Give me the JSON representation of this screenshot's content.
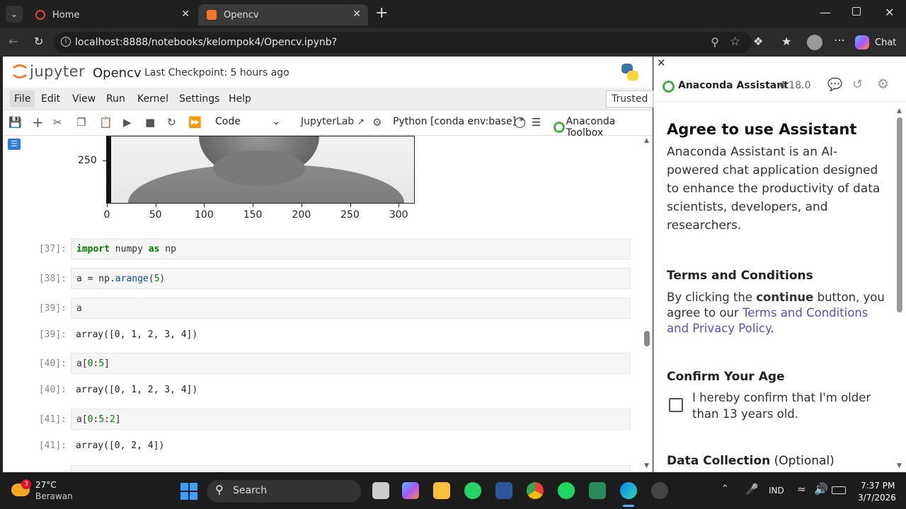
{
  "browser": {
    "tabs": [
      {
        "title": "Home"
      },
      {
        "title": "Opencv"
      }
    ],
    "url": "localhost:8888/notebooks/kelompok4/Opencv.ipynb?",
    "chat_label": "Chat"
  },
  "jupyter": {
    "logo_text": "jupyter",
    "notebook_name": "Opencv",
    "checkpoint": "Last Checkpoint: 5 hours ago",
    "menus": [
      "File",
      "Edit",
      "View",
      "Run",
      "Kernel",
      "Settings",
      "Help"
    ],
    "trusted": "Trusted",
    "cell_type": "Code",
    "jupyterlab_label": "JupyterLab",
    "kernel": "Python [conda env:base] *",
    "toolbox": "Anaconda Toolbox"
  },
  "plot": {
    "ytick": "250",
    "xticks": [
      "0",
      "50",
      "100",
      "150",
      "200",
      "250",
      "300"
    ]
  },
  "cells": [
    {
      "prompt": "[37]:",
      "code_parts": [
        {
          "t": "import",
          "c": "kw"
        },
        {
          "t": " numpy ",
          "c": ""
        },
        {
          "t": "as",
          "c": "kw"
        },
        {
          "t": " np",
          "c": ""
        }
      ]
    },
    {
      "prompt": "[38]:",
      "code_parts": [
        {
          "t": "a = np.",
          "c": ""
        },
        {
          "t": "arange",
          "c": "fn"
        },
        {
          "t": "(",
          "c": ""
        },
        {
          "t": "5",
          "c": "num"
        },
        {
          "t": ")",
          "c": ""
        }
      ]
    },
    {
      "prompt": "[39]:",
      "code_parts": [
        {
          "t": "a",
          "c": ""
        }
      ],
      "out_prompt": "[39]:",
      "output": "array([0, 1, 2, 3, 4])"
    },
    {
      "prompt": "[40]:",
      "code_parts": [
        {
          "t": "a[",
          "c": ""
        },
        {
          "t": "0",
          "c": "num"
        },
        {
          "t": ":",
          "c": ""
        },
        {
          "t": "5",
          "c": "num"
        },
        {
          "t": "]",
          "c": ""
        }
      ],
      "out_prompt": "[40]:",
      "output": "array([0, 1, 2, 3, 4])"
    },
    {
      "prompt": "[41]:",
      "code_parts": [
        {
          "t": "a[",
          "c": ""
        },
        {
          "t": "0",
          "c": "num"
        },
        {
          "t": ":",
          "c": ""
        },
        {
          "t": "5",
          "c": "num"
        },
        {
          "t": ":",
          "c": ""
        },
        {
          "t": "2",
          "c": "num"
        },
        {
          "t": "]",
          "c": ""
        }
      ],
      "out_prompt": "[41]:",
      "output": "array([0, 2, 4])"
    }
  ],
  "assistant": {
    "title": "Anaconda Assistant",
    "version": "4.18.0",
    "heading": "Agree to use Assistant",
    "intro": "Anaconda Assistant is an AI-powered chat application designed to enhance the productivity of data scientists, developers, and researchers.",
    "terms_heading": "Terms and Conditions",
    "terms_pre": "By clicking the ",
    "terms_bold": "continue",
    "terms_mid": " button, you agree to our ",
    "terms_link": "Terms and Conditions and Privacy Policy",
    "terms_end": ".",
    "age_heading": "Confirm Your Age",
    "age_label": "I hereby confirm that I'm older than 13 years old.",
    "data_heading": "Data Collection",
    "data_optional": "(Optional)"
  },
  "taskbar": {
    "weather_temp": "27°C",
    "weather_desc": "Berawan",
    "weather_badge": "3",
    "search_label": "Search",
    "lang": "IND",
    "time": "7:37 PM",
    "date": "3/7/2026"
  },
  "colors": {
    "jupyter_orange": "#f37726",
    "link": "#5a4bcf",
    "anaconda_green": "#43b049"
  }
}
